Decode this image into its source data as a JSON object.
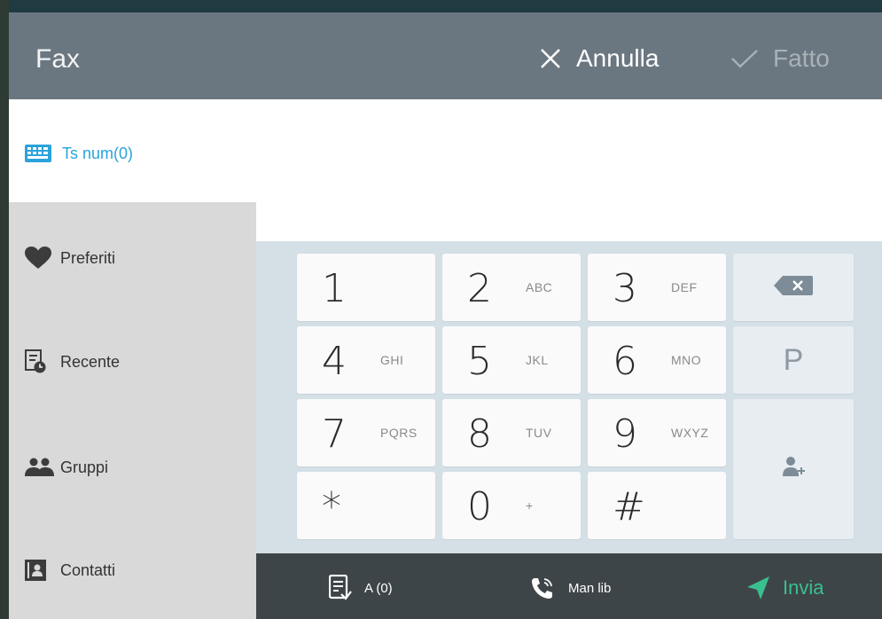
{
  "header": {
    "title": "Fax",
    "cancel_label": "Annulla",
    "done_label": "Fatto"
  },
  "numpad_tab": {
    "label": "Ts num(0)",
    "icon": "keyboard-icon",
    "color": "#2aa3dc"
  },
  "sidebar": {
    "items": [
      {
        "label": "Preferiti",
        "icon": "heart-icon"
      },
      {
        "label": "Recente",
        "icon": "recent-icon"
      },
      {
        "label": "Gruppi",
        "icon": "group-icon"
      },
      {
        "label": "Contatti",
        "icon": "contacts-icon"
      }
    ]
  },
  "keypad": {
    "keys": [
      {
        "digit": "1",
        "letters": ""
      },
      {
        "digit": "2",
        "letters": "ABC"
      },
      {
        "digit": "3",
        "letters": "DEF"
      },
      {
        "digit": "4",
        "letters": "GHI"
      },
      {
        "digit": "5",
        "letters": "JKL"
      },
      {
        "digit": "6",
        "letters": "MNO"
      },
      {
        "digit": "7",
        "letters": "PQRS"
      },
      {
        "digit": "8",
        "letters": "TUV"
      },
      {
        "digit": "9",
        "letters": "WXYZ"
      },
      {
        "digit": "*",
        "letters": ""
      },
      {
        "digit": "0",
        "letters": "+"
      },
      {
        "digit": "#",
        "letters": ""
      }
    ],
    "pause_label": "P"
  },
  "bottom_bar": {
    "recipients_label": "A (0)",
    "manual_label": "Man lib",
    "send_label": "Invia",
    "send_color": "#39c08f"
  },
  "colors": {
    "header_bg": "#6b7780",
    "keypad_bg": "#d4dfe6",
    "sidebar_bg": "#d9d9d9",
    "bottom_bar_bg": "#3e4548"
  }
}
